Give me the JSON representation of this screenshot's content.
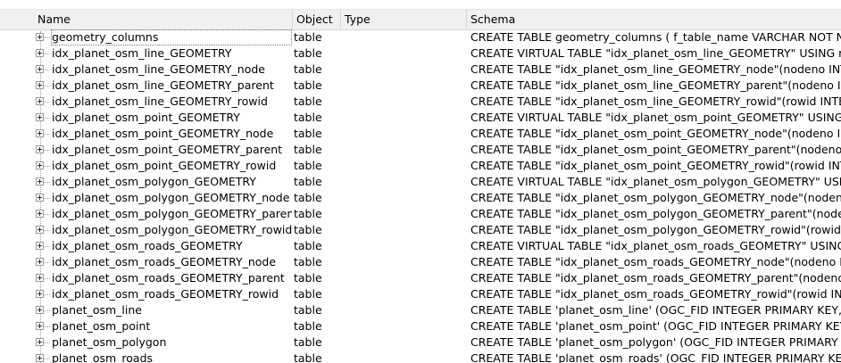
{
  "columns": {
    "name": "Name",
    "object": "Object",
    "type": "Type",
    "schema": "Schema"
  },
  "rows": [
    {
      "name": "geometry_columns",
      "object": "table",
      "type": "",
      "schema": "CREATE TABLE geometry_columns (      f_table_name VARCHAR NOT N"
    },
    {
      "name": "idx_planet_osm_line_GEOMETRY",
      "object": "table",
      "type": "",
      "schema": "CREATE VIRTUAL TABLE \"idx_planet_osm_line_GEOMETRY\" USING rtre"
    },
    {
      "name": "idx_planet_osm_line_GEOMETRY_node",
      "object": "table",
      "type": "",
      "schema": "CREATE TABLE \"idx_planet_osm_line_GEOMETRY_node\"(nodeno INTEG"
    },
    {
      "name": "idx_planet_osm_line_GEOMETRY_parent",
      "object": "table",
      "type": "",
      "schema": "CREATE TABLE \"idx_planet_osm_line_GEOMETRY_parent\"(nodeno INTE"
    },
    {
      "name": "idx_planet_osm_line_GEOMETRY_rowid",
      "object": "table",
      "type": "",
      "schema": "CREATE TABLE \"idx_planet_osm_line_GEOMETRY_rowid\"(rowid INTEGE"
    },
    {
      "name": "idx_planet_osm_point_GEOMETRY",
      "object": "table",
      "type": "",
      "schema": "CREATE VIRTUAL TABLE \"idx_planet_osm_point_GEOMETRY\" USING rt"
    },
    {
      "name": "idx_planet_osm_point_GEOMETRY_node",
      "object": "table",
      "type": "",
      "schema": "CREATE TABLE \"idx_planet_osm_point_GEOMETRY_node\"(nodeno INTE"
    },
    {
      "name": "idx_planet_osm_point_GEOMETRY_parent",
      "object": "table",
      "type": "",
      "schema": "CREATE TABLE \"idx_planet_osm_point_GEOMETRY_parent\"(nodeno IN"
    },
    {
      "name": "idx_planet_osm_point_GEOMETRY_rowid",
      "object": "table",
      "type": "",
      "schema": "CREATE TABLE \"idx_planet_osm_point_GEOMETRY_rowid\"(rowid INTEG"
    },
    {
      "name": "idx_planet_osm_polygon_GEOMETRY",
      "object": "table",
      "type": "",
      "schema": "CREATE VIRTUAL TABLE \"idx_planet_osm_polygon_GEOMETRY\" USING"
    },
    {
      "name": "idx_planet_osm_polygon_GEOMETRY_node",
      "object": "table",
      "type": "",
      "schema": "CREATE TABLE \"idx_planet_osm_polygon_GEOMETRY_node\"(nodeno I"
    },
    {
      "name": "idx_planet_osm_polygon_GEOMETRY_parent",
      "object": "table",
      "type": "",
      "schema": "CREATE TABLE \"idx_planet_osm_polygon_GEOMETRY_parent\"(nodeno"
    },
    {
      "name": "idx_planet_osm_polygon_GEOMETRY_rowid",
      "object": "table",
      "type": "",
      "schema": "CREATE TABLE \"idx_planet_osm_polygon_GEOMETRY_rowid\"(rowid IN"
    },
    {
      "name": "idx_planet_osm_roads_GEOMETRY",
      "object": "table",
      "type": "",
      "schema": "CREATE VIRTUAL TABLE \"idx_planet_osm_roads_GEOMETRY\" USING r"
    },
    {
      "name": "idx_planet_osm_roads_GEOMETRY_node",
      "object": "table",
      "type": "",
      "schema": "CREATE TABLE \"idx_planet_osm_roads_GEOMETRY_node\"(nodeno INT"
    },
    {
      "name": "idx_planet_osm_roads_GEOMETRY_parent",
      "object": "table",
      "type": "",
      "schema": "CREATE TABLE \"idx_planet_osm_roads_GEOMETRY_parent\"(nodeno IN"
    },
    {
      "name": "idx_planet_osm_roads_GEOMETRY_rowid",
      "object": "table",
      "type": "",
      "schema": "CREATE TABLE \"idx_planet_osm_roads_GEOMETRY_rowid\"(rowid INTE"
    },
    {
      "name": "planet_osm_line",
      "object": "table",
      "type": "",
      "schema": "CREATE TABLE 'planet_osm_line' (OGC_FID INTEGER PRIMARY KEY,GE"
    },
    {
      "name": "planet_osm_point",
      "object": "table",
      "type": "",
      "schema": "CREATE TABLE 'planet_osm_point' (OGC_FID INTEGER PRIMARY KEY,GE"
    },
    {
      "name": "planet_osm_polygon",
      "object": "table",
      "type": "",
      "schema": "CREATE TABLE 'planet_osm_polygon' (OGC_FID INTEGER PRIMARY KEY,"
    },
    {
      "name": "planet_osm_roads",
      "object": "table",
      "type": "",
      "schema": "CREATE TABLE 'planet_osm_roads' (OGC_FID INTEGER PRIMARY KEY,G"
    }
  ]
}
